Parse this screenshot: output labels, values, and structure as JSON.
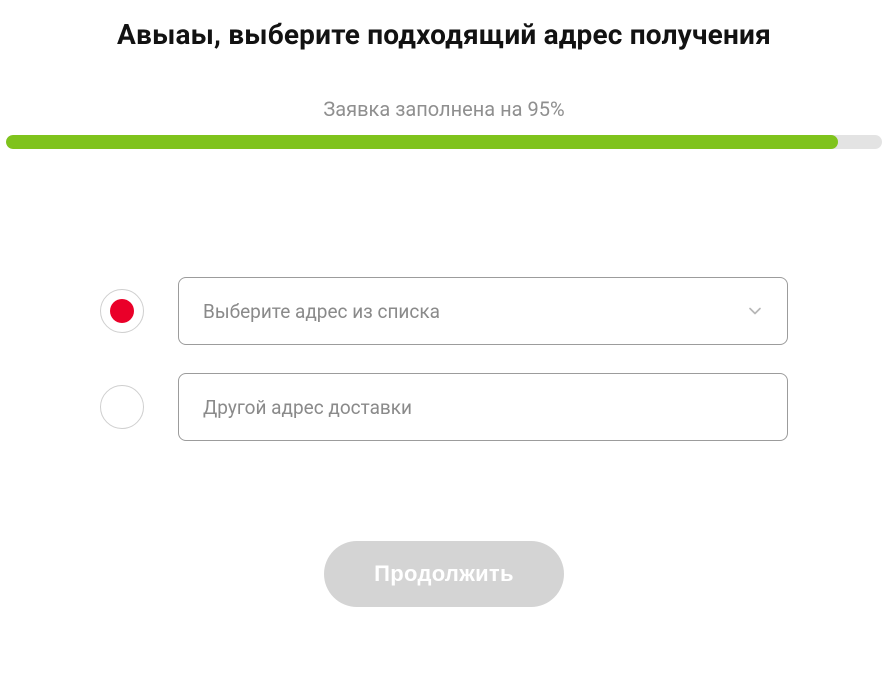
{
  "title": "Авыаы, выберите подходящий адрес получения",
  "progress": {
    "label": "Заявка заполнена на 95%",
    "percent": 95
  },
  "options": {
    "select": {
      "placeholder": "Выберите адрес из списка",
      "selected": true
    },
    "other": {
      "placeholder": "Другой адрес доставки",
      "selected": false
    }
  },
  "continue_label": "Продолжить",
  "colors": {
    "accent_green": "#7fc31c",
    "error_red": "#ea0029",
    "disabled_grey": "#d4d4d4"
  }
}
